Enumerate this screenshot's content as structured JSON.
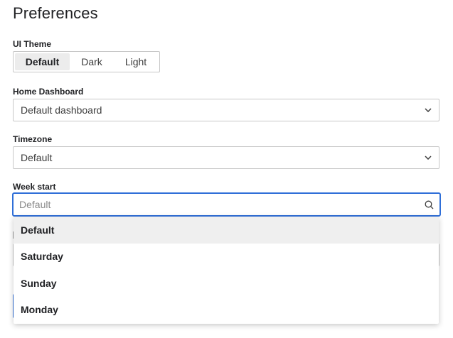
{
  "page": {
    "title": "Preferences"
  },
  "theme": {
    "label": "UI Theme",
    "options": [
      "Default",
      "Dark",
      "Light"
    ],
    "selected": "Default"
  },
  "home_dashboard": {
    "label": "Home Dashboard",
    "value": "Default dashboard"
  },
  "timezone": {
    "label": "Timezone",
    "value": "Default"
  },
  "week_start": {
    "label": "Week start",
    "placeholder": "Default",
    "options": [
      "Default",
      "Saturday",
      "Sunday",
      "Monday"
    ],
    "highlighted": "Default"
  },
  "colors": {
    "focus_border": "#2f6fd8",
    "primary_button": "#2f6fd8",
    "highlight_bg": "#efefef"
  },
  "icons": {
    "chevron": "chevron-down-icon",
    "search": "search-icon"
  }
}
